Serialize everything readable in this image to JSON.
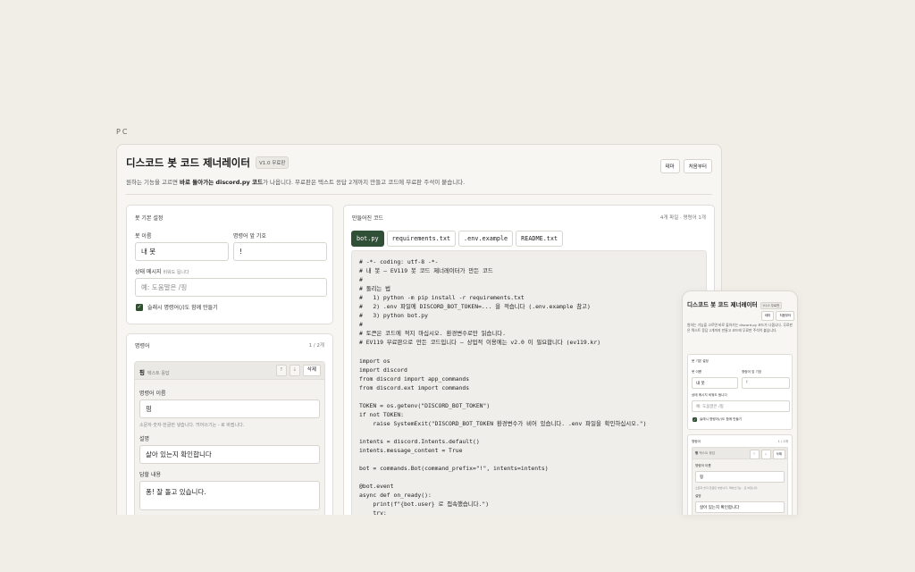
{
  "device_label": "PC",
  "app": {
    "title": "디스코드 봇 코드 제너레이터",
    "version_badge": "V1.0 무료판",
    "theme_button": "테마",
    "reset_button": "처음부터",
    "subtitle_pre": "원하는 기능을 고르면 ",
    "subtitle_bold": "바로 돌아가는 discord.py 코드",
    "subtitle_post": "가 나옵니다. 무료판은 텍스트 응답 2개까지 만들고 코드에 무료판 주석이 붙습니다."
  },
  "basic": {
    "title": "봇 기본 설정",
    "bot_name_label": "봇 이름",
    "bot_name_value": "내 봇",
    "prefix_label": "명령어 앞 기호",
    "prefix_value": "!",
    "status_label": "상태 메시지",
    "status_hint": "비워도 됩니다",
    "status_placeholder": "예: 도움말은 /핑",
    "slash_label": "슬래시 명령어(/)도 함께 만들기",
    "slash_checked": true
  },
  "commands": {
    "title": "명령어",
    "count": "1 / 2개",
    "card": {
      "name": "핑",
      "type": "텍스트 응답",
      "up": "↑",
      "down": "↓",
      "delete": "삭제",
      "name_label": "명령어 이름",
      "name_value": "핑",
      "name_hint": "소문자·숫자·한글만 넣습니다. 띄어쓰기는 - 로 바뀝니다.",
      "desc_label": "설명",
      "desc_value": "살아 있는지 확인합니다",
      "reply_label": "답할 내용",
      "reply_value": "퐁! 잘 돌고 있습니다."
    }
  },
  "code": {
    "title": "만들어진 코드",
    "meta": "4개 파일 · 명령어 1개",
    "tabs": [
      "bot.py",
      "requirements.txt",
      ".env.example",
      "README.txt"
    ],
    "active_tab": 0,
    "content": "# -*- coding: utf-8 -*-\n# 내 봇 — EV119 봇 코드 제너레이터가 만든 코드\n#\n# 돌리는 법\n#   1) python -m pip install -r requirements.txt\n#   2) .env 파일에 DISCORD_BOT_TOKEN=... 을 적습니다 (.env.example 참고)\n#   3) python bot.py\n#\n# 토큰은 코드에 적지 마십시오. 환경변수로만 읽습니다.\n# EV119 무료판으로 만든 코드입니다 — 상업적 이용에는 v2.0 이 필요합니다 (ev119.kr)\n\nimport os\nimport discord\nfrom discord import app_commands\nfrom discord.ext import commands\n\nTOKEN = os.getenv(\"DISCORD_BOT_TOKEN\")\nif not TOKEN:\n    raise SystemExit(\"DISCORD_BOT_TOKEN 환경변수가 비어 있습니다. .env 파일을 확인하십시오.\")\n\nintents = discord.Intents.default()\nintents.message_content = True\n\nbot = commands.Bot(command_prefix=\"!\", intents=intents)\n\n@bot.event\nasync def on_ready():\n    print(f\"{bot.user} 로 접속했습니다.\")\n    try:"
  },
  "mobile": {
    "title": "디스코드 봇 코드 제너레이터",
    "badge": "V1.0 무료판",
    "theme_button": "테마",
    "reset_button": "처음부터",
    "subtitle": "원하는 기능을 고르면 바로 돌아가는 discord.py 코드가 나옵니다. 무료판은 텍스트 응답 2개까지 만들고 코드에 무료판 주석이 붙습니다.",
    "basic_title": "봇 기본 설정",
    "bot_name_label": "봇 이름",
    "bot_name_value": "내 봇",
    "prefix_label": "명령어 앞 기호",
    "prefix_value": "!",
    "status_label": "상태 메시지 비워도 됩니다",
    "status_placeholder": "예: 도움말은 /핑",
    "slash_label": "슬래시 명령어(/)도 함께 만들기",
    "commands_title": "명령어",
    "commands_count": "1 / 2개",
    "cmd_name": "핑",
    "cmd_type": "텍스트 응답",
    "up": "↑",
    "down": "↓",
    "delete": "삭제",
    "name_label": "명령어 이름",
    "name_value": "핑",
    "name_hint": "소문자·숫자·한글만 넣습니다. 띄어쓰기는 - 로 바뀝니다.",
    "desc_label": "설명",
    "desc_value": "살아 있는지 확인합니다"
  },
  "colors": {
    "background": "#f1eee8",
    "accent": "#2f4f36",
    "code_bg": "#efeeeb"
  }
}
